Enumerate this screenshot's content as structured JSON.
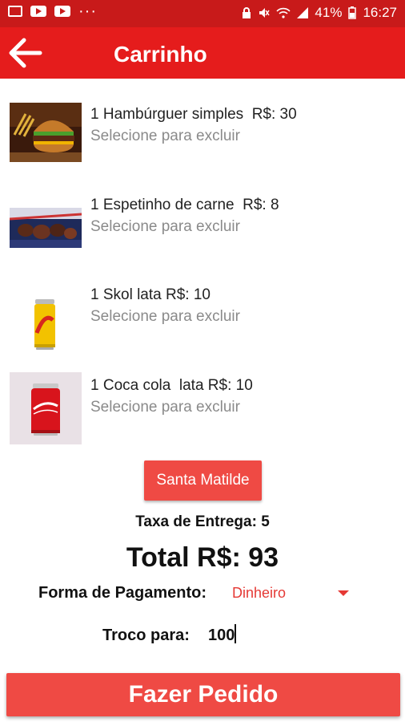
{
  "status_bar": {
    "battery": "41%",
    "time": "16:27",
    "overflow": "···",
    "icons": [
      "image-icon",
      "youtube-icon",
      "youtube-icon",
      "lock-icon",
      "mute-icon",
      "wifi-icon",
      "signal-icon"
    ]
  },
  "app_bar": {
    "title": "Carrinho",
    "back_icon": "arrow-left-icon"
  },
  "cart": {
    "items": [
      {
        "name": "1 Hambúrguer simples  R$: 30",
        "action": "Selecione para excluir",
        "image": "hamburger"
      },
      {
        "name": "1 Espetinho de carne  R$: 8",
        "action": "Selecione para excluir",
        "image": "skewer"
      },
      {
        "name": "1 Skol lata R$: 10",
        "action": "Selecione para excluir",
        "image": "beer-can"
      },
      {
        "name": "1 Coca cola  lata R$: 10",
        "action": "Selecione para excluir",
        "image": "soda-can"
      }
    ]
  },
  "neighborhood_button": "Santa Matilde",
  "delivery_fee": "Taxa de Entrega:  5",
  "total": "Total R$: 93",
  "payment": {
    "label": "Forma de Pagamento:",
    "value": "Dinheiro"
  },
  "change": {
    "label": "Troco para:",
    "value": "100"
  },
  "order_button": "Fazer Pedido",
  "colors": {
    "status_bar": "#c81a1a",
    "app_bar": "#e51c1c",
    "button": "#ef4a44",
    "accent_text": "#e53935"
  }
}
